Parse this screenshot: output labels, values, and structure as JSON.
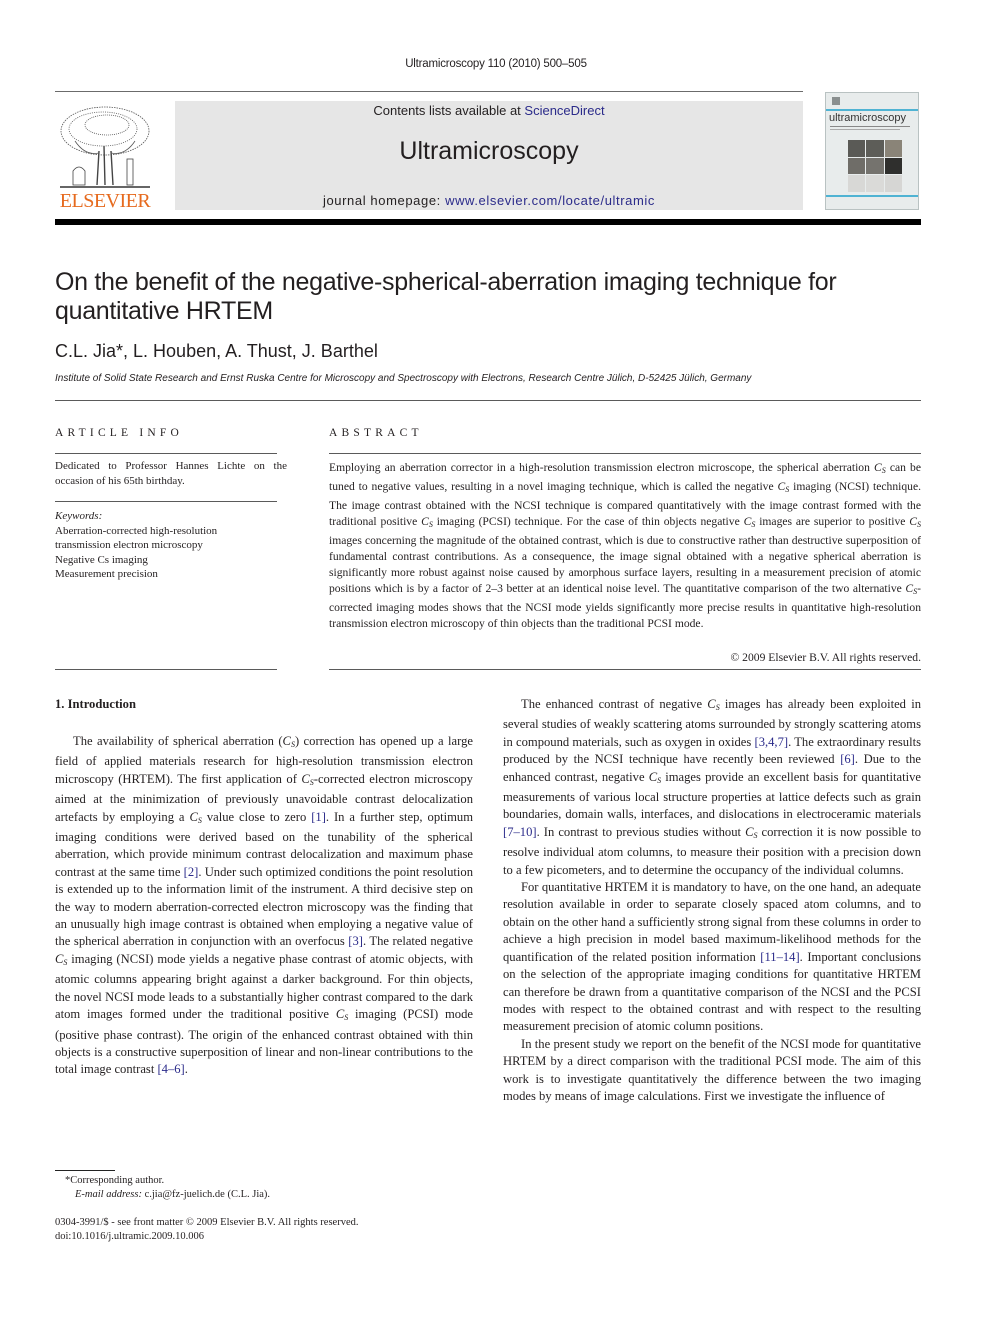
{
  "running_head": "Ultramicroscopy 110 (2010) 500–505",
  "header": {
    "contents_prefix": "Contents lists available at ",
    "contents_link": "ScienceDirect",
    "journal_name": "Ultramicroscopy",
    "homepage_prefix": "journal homepage: ",
    "homepage_link": "www.elsevier.com/locate/ultramic",
    "publisher_logo_text": "ELSEVIER",
    "cover_title": "ultramicroscopy",
    "link_color": "#2b2b8a",
    "publisher_color": "#e66a1e"
  },
  "article": {
    "title_line1": "On the benefit of the negative-spherical-aberration imaging technique for",
    "title_line2": "quantitative HRTEM",
    "authors": "C.L. Jia*, L. Houben, A. Thust, J. Barthel",
    "affiliation": "Institute of Solid State Research and Ernst Ruska Centre for Microscopy and Spectroscopy with Electrons, Research Centre Jülich, D-52425 Jülich, Germany"
  },
  "article_info": {
    "label": "ARTICLE INFO",
    "dedication": "Dedicated to Professor Hannes Lichte on the occasion of his 65th birthday.",
    "keywords_label": "Keywords:",
    "keywords": [
      "Aberration-corrected high-resolution transmission electron microscopy",
      "Negative Cs imaging",
      "Measurement precision"
    ]
  },
  "abstract": {
    "label": "ABSTRACT",
    "text": [
      "Employing an aberration corrector in a high-resolution transmission electron microscope, the spherical aberration ",
      "C",
      "S",
      " can be tuned to negative values, resulting in a novel imaging technique, which is called the negative ",
      " imaging (NCSI) technique. The image contrast obtained with the NCSI technique is compared quantitatively with the image contrast formed with the traditional positive ",
      " imaging (PCSI) technique. For the case of thin objects negative ",
      " images are superior to positive ",
      " images concerning the magnitude of the obtained contrast, which is due to constructive rather than destructive superposition of fundamental contrast contributions. As a consequence, the image signal obtained with a negative spherical aberration is significantly more robust against noise caused by amorphous surface layers, resulting in a measurement precision of atomic positions which is by a factor of 2–3 better at an identical noise level. The quantitative comparison of the two alternative ",
      "-corrected imaging modes shows that the NCSI mode yields significantly more precise results in quantitative high-resolution transmission electron microscopy of thin objects than the traditional PCSI mode."
    ],
    "copyright": "© 2009 Elsevier B.V. All rights reserved."
  },
  "introduction": {
    "heading": "1.  Introduction",
    "left_p1": [
      "The availability of spherical aberration (",
      ") correction has opened up a large field of applied materials research for high-resolution transmission electron microscopy (HRTEM). The first application of ",
      "-corrected electron microscopy aimed at the minimization of previously unavoidable contrast delocalization artefacts by employing a ",
      " value close to zero ",
      "[1]",
      ". In a further step, optimum imaging conditions were derived based on the tunability of the spherical aberration, which provide minimum contrast delocalization and maximum phase contrast at the same time ",
      "[2]",
      ". Under such optimized conditions the point resolution is extended up to the information limit of the instrument. A third decisive step on the way to modern aberration-corrected electron microscopy was the finding that an unusually high image contrast is obtained when employing a negative value of the spherical aberration in conjunction with an overfocus ",
      "[3]",
      ". The related negative ",
      " imaging (NCSI) mode yields a negative phase contrast of atomic objects, with atomic columns appearing bright against a darker background. For thin objects, the novel NCSI mode leads to a substantially higher contrast compared to the dark atom images formed under the traditional positive ",
      " imaging (PCSI) mode (positive phase contrast). The origin of the enhanced contrast obtained with thin objects is a constructive superposition of linear and non-linear contributions to the total image contrast ",
      "[4–6]",
      "."
    ],
    "right_p1": [
      "The enhanced contrast of negative ",
      " images has already been exploited in several studies of weakly scattering atoms surrounded by strongly scattering atoms in compound materials, such as oxygen in oxides ",
      "[3,4,7]",
      ". The extraordinary results produced by the NCSI technique have recently been reviewed ",
      "[6]",
      ". Due to the enhanced contrast, negative ",
      " images provide an excellent basis for quantitative measurements of various local structure properties at lattice defects such as grain boundaries, domain walls, interfaces, and dislocations in electroceramic materials ",
      "[7–10]",
      ". In contrast to previous studies without ",
      " correction it is now possible to resolve individual atom columns, to measure their position with a precision down to a few picometers, and to determine the occupancy of the individual columns."
    ],
    "right_p2": [
      "For quantitative HRTEM it is mandatory to have, on the one hand, an adequate resolution available in order to separate closely spaced atom columns, and to obtain on the other hand a sufficiently strong signal from these columns in order to achieve a high precision in model based maximum-likelihood methods for the quantification of the related position information ",
      "[11–14]",
      ". Important conclusions on the selection of the appropriate imaging conditions for quantitative HRTEM can therefore be drawn from a quantitative comparison of the NCSI and the PCSI modes with respect to the obtained contrast and with respect to the resulting measurement precision of atomic column positions."
    ],
    "right_p3": "In the present study we report on the benefit of the NCSI mode for quantitative HRTEM by a direct comparison with the traditional PCSI mode. The aim of this work is to investigate quantitatively the difference between the two imaging modes by means of image calculations. First we investigate the influence of"
  },
  "footnotes": {
    "corresponding": "*Corresponding author.",
    "email_label": "E-mail address:",
    "email_value": " c.jia@fz-juelich.de (C.L. Jia).",
    "front_matter": "0304-3991/$ - see front matter © 2009 Elsevier B.V. All rights reserved.",
    "doi": "doi:10.1016/j.ultramic.2009.10.006"
  }
}
